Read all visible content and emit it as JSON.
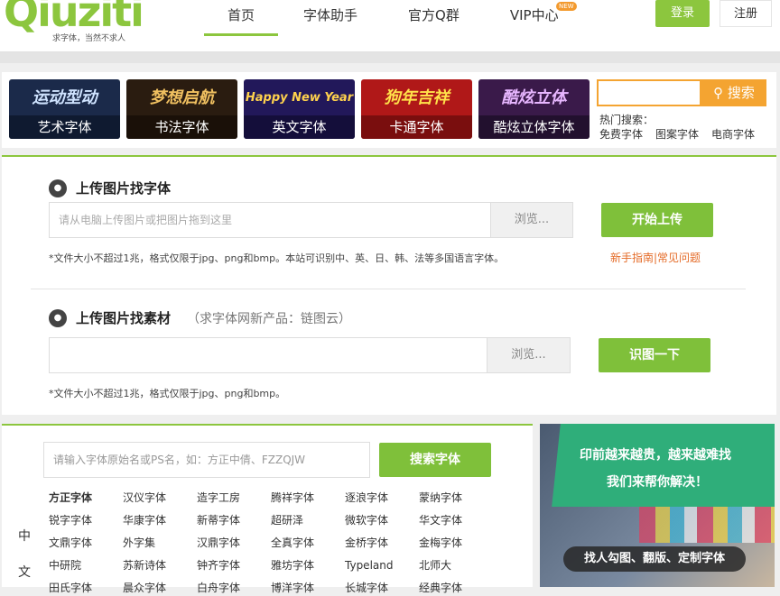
{
  "header": {
    "logo_text": "Qiuziti",
    "logo_tagline": "求字体，当然不求人",
    "nav": [
      {
        "label": "首页",
        "active": true
      },
      {
        "label": "字体助手",
        "active": false
      },
      {
        "label": "官方Q群",
        "active": false
      },
      {
        "label": "VIP中心",
        "active": false,
        "badge": "NEW"
      }
    ],
    "login_label": "登录",
    "register_label": "注册"
  },
  "banner": {
    "categories": [
      {
        "art": "运动型动",
        "label": "艺术字体",
        "bg": "#1b2a4a",
        "fg": "#cfe3ff"
      },
      {
        "art": "梦想启航",
        "label": "书法字体",
        "bg": "#2a1c10",
        "fg": "#f0c060"
      },
      {
        "art": "Happy New Year",
        "label": "英文字体",
        "bg": "#22185a",
        "fg": "#ffd24d"
      },
      {
        "art": "狗年吉祥",
        "label": "卡通字体",
        "bg": "#b01818",
        "fg": "#ffe14a"
      },
      {
        "art": "酷炫立体",
        "label": "酷炫立体字体",
        "bg": "#3a1a4a",
        "fg": "#e7b6ff"
      }
    ],
    "search_placeholder": "",
    "search_button": "搜索",
    "hot_label": "热门搜索：",
    "hot_links": [
      "免费字体",
      "图案字体",
      "电商字体"
    ]
  },
  "upload_font": {
    "title": "上传图片找字体",
    "placeholder": "请从电脑上传图片或把图片拖到这里",
    "browse": "浏览...",
    "button": "开始上传",
    "note": "*文件大小不超过1兆，格式仅限于jpg、png和bmp。本站可识别中、英、日、韩、法等多国语言字体。",
    "help": "新手指南|常见问题"
  },
  "upload_material": {
    "title": "上传图片找素材",
    "subtitle": "（求字体网新产品：链图云）",
    "browse": "浏览...",
    "button": "识图一下",
    "note": "*文件大小不超过1兆，格式仅限于jpg、png和bmp。"
  },
  "font_search": {
    "placeholder": "请输入字体原始名或PS名，如：方正中倩、FZZQJW",
    "button": "搜索字体",
    "lang_label_1": "中",
    "lang_label_2": "文",
    "fonts": [
      "方正字体",
      "汉仪字体",
      "造字工房",
      "腾祥字体",
      "逐浪字体",
      "蒙纳字体",
      "锐字字体",
      "华康字体",
      "新蒂字体",
      "超研泽",
      "微软字体",
      "华文字体",
      "文鼎字体",
      "外字集",
      "汉鼎字体",
      "全真字体",
      "金桥字体",
      "金梅字体",
      "中研院",
      "苏新诗体",
      "钟齐字体",
      "雅坊字体",
      "Typeland",
      "北师大",
      "田氏字体",
      "晨众字体",
      "白舟字体",
      "博洋字体",
      "长城字体",
      "经典字体"
    ]
  },
  "ad": {
    "line1": "印前越来越贵，越来越难找",
    "line2": "我们来帮你解决！",
    "pill": "找人勾图、翻版、定制字体"
  },
  "colors": {
    "brand_green": "#8cc63e",
    "accent_orange": "#f4a431",
    "link_orange": "#e46a26"
  }
}
